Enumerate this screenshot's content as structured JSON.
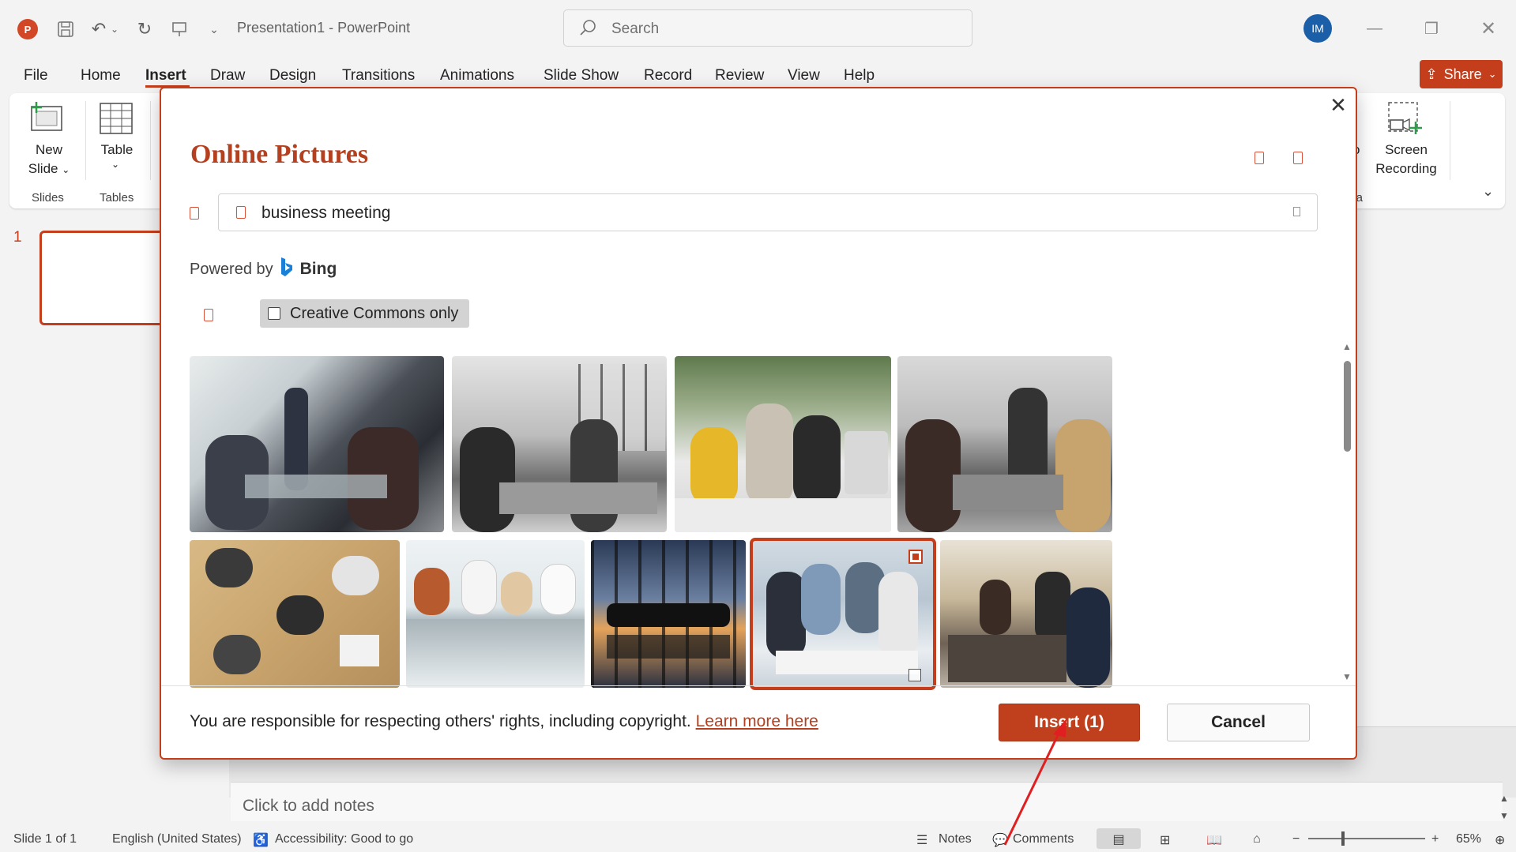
{
  "app": {
    "title": "Presentation1  -  PowerPoint",
    "search_placeholder": "Search",
    "avatar_initials": "IM",
    "share_label": "Share"
  },
  "menu": [
    "File",
    "Home",
    "Insert",
    "Draw",
    "Design",
    "Transitions",
    "Animations",
    "Slide Show",
    "Record",
    "Review",
    "View",
    "Help"
  ],
  "ribbon": {
    "new_slide": "New",
    "new_slide_2": "Slide",
    "table": "Table",
    "slides_group": "Slides",
    "tables_group": "Tables",
    "screen_rec_1": "Screen",
    "screen_rec_2": "Recording",
    "media_group_partial": "lia",
    "media_partial": "o"
  },
  "slide_pane": {
    "number": "1"
  },
  "notes_placeholder": "Click to add notes",
  "status": {
    "slide": "Slide 1 of 1",
    "language": "English (United States)",
    "accessibility": "Accessibility: Good to go",
    "notes": "Notes",
    "comments": "Comments",
    "zoom": "65%"
  },
  "dialog": {
    "title": "Online Pictures",
    "query": "business meeting",
    "powered_by": "Powered by",
    "bing": "Bing",
    "cc_label": "Creative Commons only",
    "rights_text": "You are responsible for respecting others' rights, including copyright.",
    "learn_more": "Learn more here",
    "insert_label": "Insert (1)",
    "cancel_label": "Cancel"
  },
  "colors": {
    "accent": "#c43e1c",
    "title_red": "#b4401f"
  }
}
